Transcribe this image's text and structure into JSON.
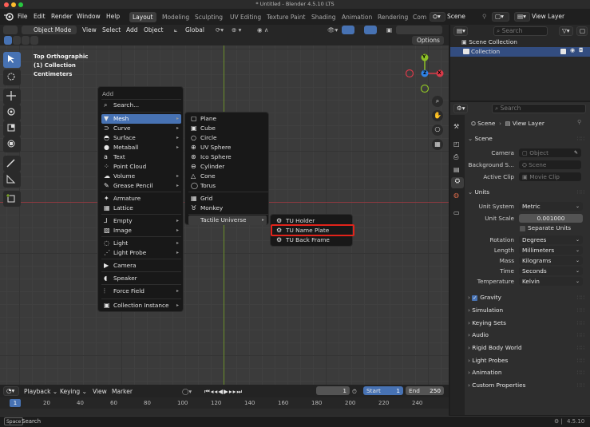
{
  "window": {
    "title": "* Untitled - Blender 4.5.10 LTS"
  },
  "top_menu": [
    "File",
    "Edit",
    "Render",
    "Window",
    "Help"
  ],
  "workspaces": [
    "Layout",
    "Modeling",
    "Sculpting",
    "UV Editing",
    "Texture Paint",
    "Shading",
    "Animation",
    "Rendering",
    "Com"
  ],
  "active_workspace": "Layout",
  "scene_name": "Scene",
  "view_layer_name": "View Layer",
  "viewport_header": {
    "mode": "Object Mode",
    "menus": [
      "View",
      "Select",
      "Add",
      "Object"
    ],
    "transform_orientation": "Global",
    "options_label": "Options"
  },
  "viewport_overlay": {
    "view_name": "Top Orthographic",
    "collection": "(1) Collection",
    "units": "Centimeters"
  },
  "gizmo": {
    "y_label": "Y",
    "x_label": "X",
    "z_label": "Z"
  },
  "add_menu": {
    "title": "Add",
    "search": "Search...",
    "items": [
      {
        "label": "Mesh",
        "submenu": true,
        "highlighted": true
      },
      {
        "label": "Curve",
        "submenu": true
      },
      {
        "label": "Surface",
        "submenu": true
      },
      {
        "label": "Metaball",
        "submenu": true
      },
      {
        "label": "Text",
        "submenu": false
      },
      {
        "label": "Point Cloud",
        "submenu": false
      },
      {
        "label": "Volume",
        "submenu": true
      },
      {
        "label": "Grease Pencil",
        "submenu": true
      },
      {
        "label": "Armature",
        "submenu": false
      },
      {
        "label": "Lattice",
        "submenu": false
      },
      {
        "label": "Empty",
        "submenu": true
      },
      {
        "label": "Image",
        "submenu": true
      },
      {
        "label": "Light",
        "submenu": true
      },
      {
        "label": "Light Probe",
        "submenu": true
      },
      {
        "label": "Camera",
        "submenu": false
      },
      {
        "label": "Speaker",
        "submenu": false
      },
      {
        "label": "Force Field",
        "submenu": true
      },
      {
        "label": "Collection Instance",
        "submenu": true
      }
    ]
  },
  "mesh_menu": {
    "items": [
      "Plane",
      "Cube",
      "Circle",
      "UV Sphere",
      "Ico Sphere",
      "Cylinder",
      "Cone",
      "Torus",
      "Grid",
      "Monkey"
    ],
    "submenu_label": "Tactile Universe"
  },
  "tactile_menu": {
    "items": [
      "TU Holder",
      "TU Name Plate",
      "TU Back Frame"
    ],
    "highlighted": "TU Name Plate"
  },
  "outliner": {
    "search_placeholder": "Search",
    "items": [
      "Scene Collection",
      "Collection"
    ]
  },
  "properties": {
    "search_placeholder": "Search",
    "breadcrumb": [
      "Scene",
      "View Layer"
    ],
    "scene_section": {
      "title": "Scene",
      "camera_label": "Camera",
      "camera_placeholder": "Object",
      "bg_label": "Background S...",
      "bg_placeholder": "Scene",
      "clip_label": "Active Clip",
      "clip_placeholder": "Movie Clip"
    },
    "units_section": {
      "title": "Units",
      "unit_system_label": "Unit System",
      "unit_system": "Metric",
      "unit_scale_label": "Unit Scale",
      "unit_scale": "0.001000",
      "separate_units": "Separate Units",
      "rotation_label": "Rotation",
      "rotation": "Degrees",
      "length_label": "Length",
      "length": "Millimeters",
      "mass_label": "Mass",
      "mass": "Kilograms",
      "time_label": "Time",
      "time": "Seconds",
      "temperature_label": "Temperature",
      "temperature": "Kelvin"
    },
    "collapsed_sections": [
      "Gravity",
      "Simulation",
      "Keying Sets",
      "Audio",
      "Rigid Body World",
      "Light Probes",
      "Animation",
      "Custom Properties"
    ],
    "gravity_checked": true
  },
  "timeline": {
    "menus": [
      "Playback",
      "Keying",
      "View",
      "Marker"
    ],
    "current_frame": "1",
    "start_label": "Start",
    "start": "1",
    "end_label": "End",
    "end": "250",
    "ruler": [
      "1",
      "20",
      "40",
      "60",
      "80",
      "100",
      "120",
      "140",
      "160",
      "180",
      "200",
      "220",
      "240"
    ]
  },
  "statusbar": {
    "key": "Space",
    "action": "Search",
    "version": "4.5.10"
  },
  "colors": {
    "accent": "#4772b3",
    "highlight_box": "#e2231a",
    "x_axis": "#d93a49",
    "y_axis": "#8cbf26",
    "z_axis": "#2f83e8"
  }
}
